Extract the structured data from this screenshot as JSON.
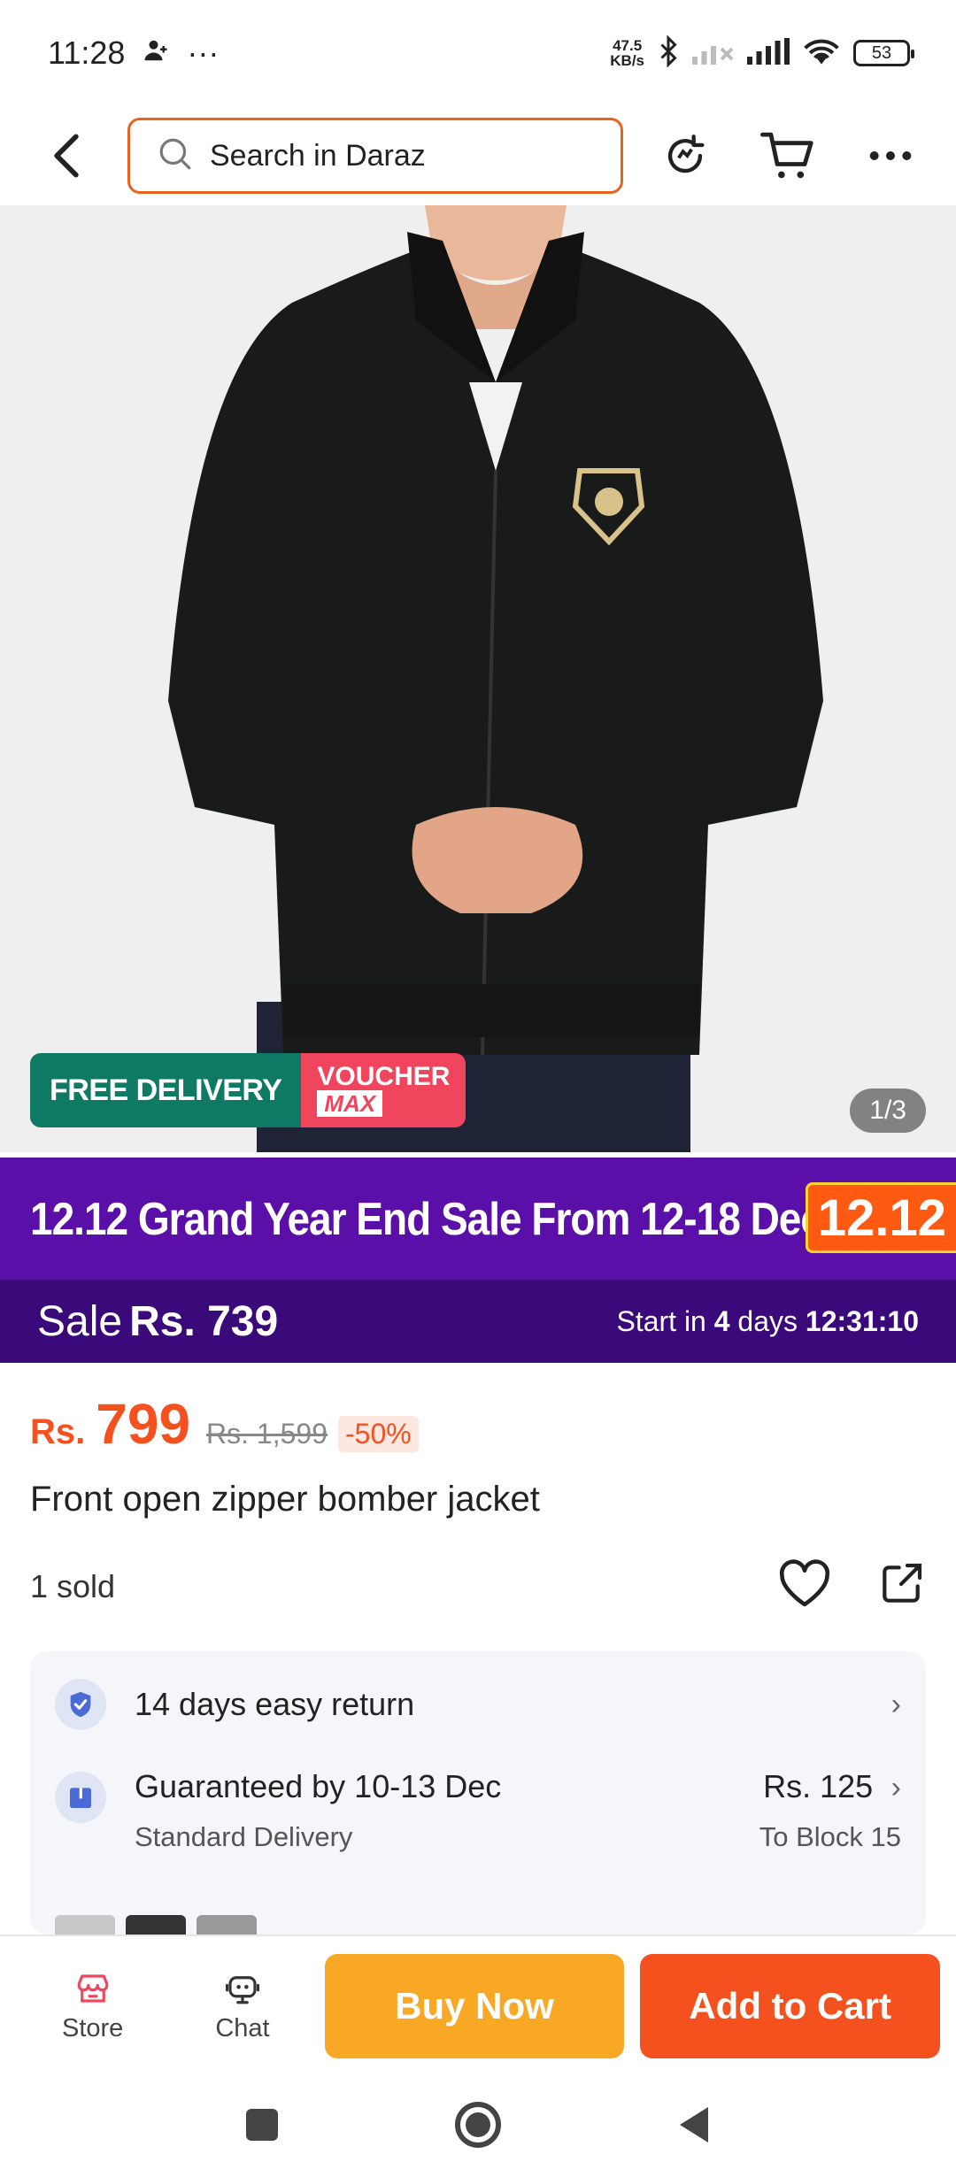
{
  "status_bar": {
    "time": "11:28",
    "more": "···",
    "net_speed_value": "47.5",
    "net_speed_unit": "KB/s",
    "battery": "53"
  },
  "nav": {
    "search_placeholder": "Search in Daraz"
  },
  "product": {
    "badge_free_delivery": "FREE DELIVERY",
    "badge_voucher": "VOUCHER",
    "badge_voucher_max": "MAX",
    "image_pager": "1/3",
    "price_currency": "Rs.",
    "price": "799",
    "original_price": "Rs. 1,599",
    "discount": "-50%",
    "title": "Front open zipper bomber jacket",
    "sold": "1 sold"
  },
  "sale": {
    "banner_text": "12.12 Grand Year End Sale From 12-18 December",
    "banner_badge": "12.12",
    "sale_label": "Sale",
    "sale_price": "Rs. 739",
    "start_prefix": "Start in",
    "start_days_num": "4",
    "start_days_word": "days",
    "countdown": "12:31:10"
  },
  "info": {
    "return_text": "14 days easy return",
    "delivery_text": "Guaranteed by 10-13 Dec",
    "delivery_sub": "Standard Delivery",
    "delivery_price": "Rs. 125",
    "delivery_location": "To Block 15"
  },
  "bottom_bar": {
    "store_label": "Store",
    "chat_label": "Chat",
    "buy_now_label": "Buy Now",
    "add_to_cart_label": "Add to Cart"
  },
  "colors": {
    "accent": "#f4511e",
    "buy_now": "#f9a825",
    "sale_banner": "#5a0fa8",
    "sale_bar": "#3b0a7a",
    "free_delivery": "#0f7a64",
    "voucher": "#f0455c"
  }
}
